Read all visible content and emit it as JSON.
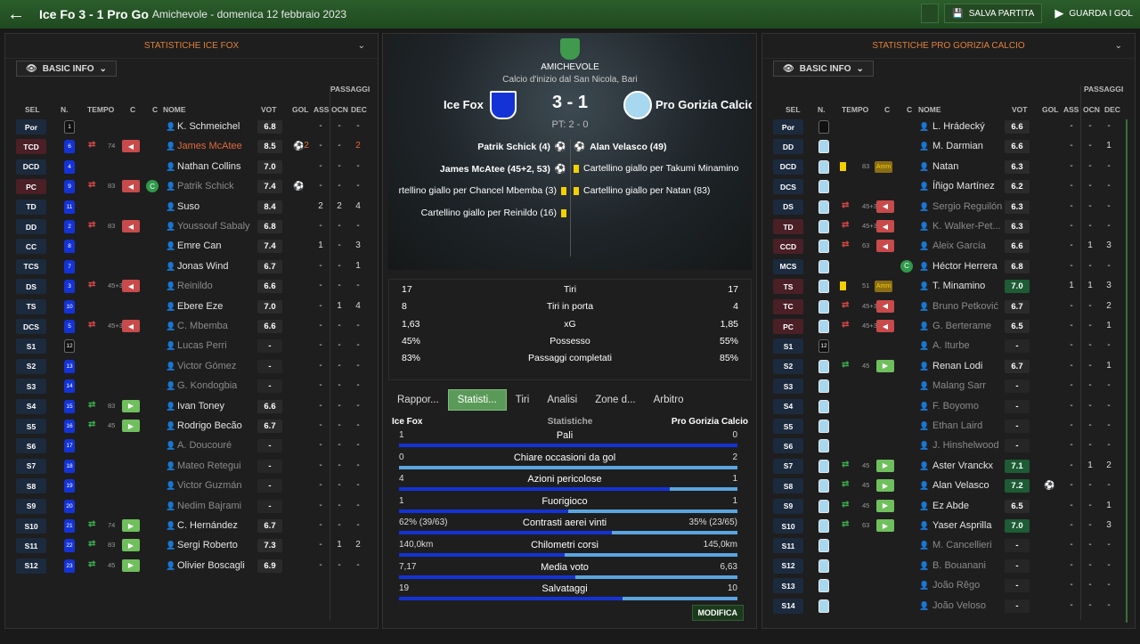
{
  "topbar": {
    "title": "Ice Fo 3 - 1 Pro Go",
    "subtitle": "Amichevole - domenica 12 febbraio 2023",
    "save_label": "SALVA PARTITA",
    "goals_label": "GUARDA I GOL"
  },
  "left": {
    "header": "STATISTICHE ICE FOX",
    "basic_info": "BASIC INFO",
    "passaggi": "PASSAGGI",
    "columns": {
      "sel": "SEL",
      "n": "N.",
      "tempo": "TEMPO",
      "c1": "C",
      "c2": "C",
      "nome": "NOME",
      "vot": "VOT",
      "gol": "GOL",
      "ass": "ASS",
      "ocn": "OCN",
      "dec": "DEC"
    },
    "players": [
      {
        "pos": "Por",
        "num": "1",
        "name": "K. Schmeichel",
        "rating": "6.8",
        "ass": "-",
        "ocn": "-",
        "dec": "-",
        "gk": true,
        "posred": false,
        "dim": false
      },
      {
        "pos": "TCD",
        "num": "6",
        "name": "James McAtee",
        "rating": "8.5",
        "gol": "2",
        "ass": "-",
        "ocn": "-",
        "dec": "2",
        "posred": true,
        "hl": true,
        "sub": "out",
        "mins": "74",
        "arrow": "out"
      },
      {
        "pos": "DCD",
        "num": "4",
        "name": "Nathan Collins",
        "rating": "7.0",
        "ass": "-",
        "ocn": "-",
        "dec": "-"
      },
      {
        "pos": "PC",
        "num": "9",
        "name": "Patrik Schick",
        "rating": "7.4",
        "gol": "1",
        "ass": "-",
        "ocn": "-",
        "dec": "-",
        "posred": true,
        "dim": true,
        "sub": "out",
        "mins": "83",
        "arrow": "out",
        "circ": "C"
      },
      {
        "pos": "TD",
        "num": "11",
        "name": "Suso",
        "rating": "8.4",
        "ass": "2",
        "ocn": "2",
        "dec": "4"
      },
      {
        "pos": "DD",
        "num": "2",
        "name": "Youssouf Sabaly",
        "rating": "6.8",
        "ass": "-",
        "ocn": "-",
        "dec": "-",
        "dim": true,
        "sub": "out",
        "mins": "83",
        "arrow": "out"
      },
      {
        "pos": "CC",
        "num": "8",
        "name": "Emre Can",
        "rating": "7.4",
        "ass": "1",
        "ocn": "-",
        "dec": "3"
      },
      {
        "pos": "TCS",
        "num": "7",
        "name": "Jonas Wind",
        "rating": "6.7",
        "ass": "-",
        "ocn": "-",
        "dec": "1"
      },
      {
        "pos": "DS",
        "num": "3",
        "name": "Reinildo",
        "rating": "6.6",
        "ass": "-",
        "ocn": "-",
        "dec": "-",
        "dim": true,
        "sub": "out",
        "mins": "45+3",
        "arrow": "out"
      },
      {
        "pos": "TS",
        "num": "10",
        "name": "Ebere Eze",
        "rating": "7.0",
        "ass": "-",
        "ocn": "1",
        "dec": "4"
      },
      {
        "pos": "DCS",
        "num": "5",
        "name": "C. Mbemba",
        "rating": "6.6",
        "ass": "-",
        "ocn": "-",
        "dec": "-",
        "dim": true,
        "sub": "out",
        "mins": "45+3",
        "arrow": "out"
      },
      {
        "pos": "S1",
        "num": "12",
        "name": "Lucas Perri",
        "rating": "-",
        "ass": "-",
        "ocn": "-",
        "dec": "-",
        "gk": true,
        "dim": true
      },
      {
        "pos": "S2",
        "num": "13",
        "name": "Victor Gómez",
        "rating": "-",
        "ass": "-",
        "ocn": "-",
        "dec": "-",
        "dim": true
      },
      {
        "pos": "S3",
        "num": "14",
        "name": "G. Kondogbia",
        "rating": "-",
        "ass": "-",
        "ocn": "-",
        "dec": "-",
        "dim": true
      },
      {
        "pos": "S4",
        "num": "15",
        "name": "Ivan Toney",
        "rating": "6.6",
        "ass": "-",
        "ocn": "-",
        "dec": "-",
        "sub": "in",
        "mins": "83",
        "arrow": "in"
      },
      {
        "pos": "S5",
        "num": "16",
        "name": "Rodrigo Becão",
        "rating": "6.7",
        "ass": "-",
        "ocn": "-",
        "dec": "-",
        "sub": "in",
        "mins": "45",
        "arrow": "in"
      },
      {
        "pos": "S6",
        "num": "17",
        "name": "A. Doucouré",
        "rating": "-",
        "ass": "-",
        "ocn": "-",
        "dec": "-",
        "dim": true
      },
      {
        "pos": "S7",
        "num": "18",
        "name": "Mateo Retegui",
        "rating": "-",
        "ass": "-",
        "ocn": "-",
        "dec": "-",
        "dim": true
      },
      {
        "pos": "S8",
        "num": "19",
        "name": "Victor Guzmán",
        "rating": "-",
        "ass": "-",
        "ocn": "-",
        "dec": "-",
        "dim": true
      },
      {
        "pos": "S9",
        "num": "20",
        "name": "Nedim Bajrami",
        "rating": "-",
        "ass": "-",
        "ocn": "-",
        "dec": "-",
        "dim": true
      },
      {
        "pos": "S10",
        "num": "21",
        "name": "C. Hernández",
        "rating": "6.7",
        "ass": "-",
        "ocn": "-",
        "dec": "-",
        "sub": "in",
        "mins": "74",
        "arrow": "in"
      },
      {
        "pos": "S11",
        "num": "22",
        "name": "Sergi Roberto",
        "rating": "7.3",
        "ass": "-",
        "ocn": "1",
        "dec": "2",
        "sub": "in",
        "mins": "83",
        "arrow": "in"
      },
      {
        "pos": "S12",
        "num": "23",
        "name": "Olivier Boscagli",
        "rating": "6.9",
        "ass": "-",
        "ocn": "-",
        "dec": "-",
        "sub": "in",
        "mins": "45",
        "arrow": "in"
      }
    ]
  },
  "center": {
    "competition": "AMICHEVOLE",
    "venue": "Calcio d'inizio dal San Nicola, Bari",
    "home_team": "Ice Fox",
    "away_team": "Pro Gorizia Calcio",
    "score": "3 - 1",
    "halftime": "PT: 2 - 0",
    "home_events": [
      {
        "text": "Patrik Schick (4)",
        "type": "goal"
      },
      {
        "text": "James McAtee (45+2, 53)",
        "type": "goal"
      },
      {
        "text": "rtellino giallo per Chancel Mbemba (3)",
        "type": "yellow"
      },
      {
        "text": "Cartellino giallo per Reinildo (16)",
        "type": "yellow"
      }
    ],
    "away_events": [
      {
        "text": "Alan Velasco (49)",
        "type": "goal"
      },
      {
        "text": "Cartellino giallo per Takumi Minamino",
        "type": "yellow"
      },
      {
        "text": "Cartellino giallo per Natan (83)",
        "type": "yellow"
      }
    ],
    "summary": [
      {
        "l": "17",
        "m": "Tiri",
        "r": "17"
      },
      {
        "l": "8",
        "m": "Tiri in porta",
        "r": "4"
      },
      {
        "l": "1,63",
        "m": "xG",
        "r": "1,85"
      },
      {
        "l": "45%",
        "m": "Possesso",
        "r": "55%"
      },
      {
        "l": "83%",
        "m": "Passaggi completati",
        "r": "85%"
      }
    ],
    "tabs": [
      "Rappor...",
      "Statisti...",
      "Tiri",
      "Analisi",
      "Zone d...",
      "Arbitro"
    ],
    "compare_head": {
      "home": "Ice Fox",
      "mid": "Statistiche",
      "away": "Pro Gorizia Calcio"
    },
    "compare": [
      {
        "l": "1",
        "m": "Pali",
        "r": "0",
        "frac": 1.0
      },
      {
        "l": "0",
        "m": "Chiare occasioni da gol",
        "r": "2",
        "frac": 0.0
      },
      {
        "l": "4",
        "m": "Azioni pericolose",
        "r": "1",
        "frac": 0.8
      },
      {
        "l": "1",
        "m": "Fuorigioco",
        "r": "1",
        "frac": 0.5
      },
      {
        "l": "62% (39/63)",
        "m": "Contrasti aerei vinti",
        "r": "35% (23/65)",
        "frac": 0.63
      },
      {
        "l": "140,0km",
        "m": "Chilometri corsi",
        "r": "145,0km",
        "frac": 0.49
      },
      {
        "l": "7,17",
        "m": "Media voto",
        "r": "6,63",
        "frac": 0.52
      },
      {
        "l": "19",
        "m": "Salvataggi",
        "r": "10",
        "frac": 0.66
      }
    ],
    "modifica": "MODIFICA"
  },
  "right": {
    "header": "STATISTICHE PRO GORIZIA CALCIO",
    "basic_info": "BASIC INFO",
    "passaggi": "PASSAGGI",
    "columns": {
      "sel": "SEL",
      "n": "N.",
      "tempo": "TEMPO",
      "c1": "C",
      "c2": "C",
      "nome": "NOME",
      "vot": "VOT",
      "gol": "GOL",
      "ass": "ASS",
      "ocn": "OCN",
      "dec": "DEC"
    },
    "players": [
      {
        "pos": "Por",
        "name": "L. Hrádecký",
        "rating": "6.6",
        "ass": "-",
        "ocn": "-",
        "dec": "-",
        "gk": true
      },
      {
        "pos": "DD",
        "name": "M. Darmian",
        "rating": "6.6",
        "ass": "-",
        "ocn": "-",
        "dec": "1"
      },
      {
        "pos": "DCD",
        "name": "Natan",
        "rating": "6.3",
        "ass": "-",
        "ocn": "-",
        "dec": "-",
        "card": true,
        "mins": "83",
        "amm": "Amm"
      },
      {
        "pos": "DCS",
        "name": "Íñigo Martínez",
        "rating": "6.2",
        "ass": "-",
        "ocn": "-",
        "dec": "-"
      },
      {
        "pos": "DS",
        "name": "Sergio Reguilón",
        "rating": "6.3",
        "ass": "-",
        "ocn": "-",
        "dec": "-",
        "dim": true,
        "sub": "out",
        "mins": "45+3",
        "arrow": "out"
      },
      {
        "pos": "TD",
        "name": "K. Walker-Pet...",
        "rating": "6.3",
        "ass": "-",
        "ocn": "-",
        "dec": "-",
        "dim": true,
        "sub": "out",
        "mins": "45+3",
        "arrow": "out",
        "posred": true
      },
      {
        "pos": "CCD",
        "name": "Aleix García",
        "rating": "6.6",
        "ass": "-",
        "ocn": "1",
        "dec": "3",
        "dim": true,
        "sub": "out",
        "mins": "63",
        "arrow": "out",
        "posred": true
      },
      {
        "pos": "MCS",
        "name": "Héctor Herrera",
        "rating": "6.8",
        "ass": "-",
        "ocn": "-",
        "dec": "-",
        "circ": "C"
      },
      {
        "pos": "TS",
        "name": "T. Minamino",
        "rating": "7.0",
        "ass": "1",
        "ocn": "1",
        "dec": "3",
        "card": true,
        "mins": "51",
        "amm": "Amm",
        "posred": true,
        "green": true
      },
      {
        "pos": "TC",
        "name": "Bruno Petković",
        "rating": "6.7",
        "ass": "-",
        "ocn": "-",
        "dec": "2",
        "dim": true,
        "sub": "out",
        "mins": "45+3",
        "arrow": "out",
        "posred": true
      },
      {
        "pos": "PC",
        "name": "G. Berterame",
        "rating": "6.5",
        "ass": "-",
        "ocn": "-",
        "dec": "1",
        "dim": true,
        "sub": "out",
        "mins": "45+3",
        "arrow": "out",
        "posred": true
      },
      {
        "pos": "S1",
        "name": "A. Iturbe",
        "rating": "-",
        "ass": "-",
        "ocn": "-",
        "dec": "-",
        "dim": true,
        "gk": true,
        "num": "12"
      },
      {
        "pos": "S2",
        "name": "Renan Lodi",
        "rating": "6.7",
        "ass": "-",
        "ocn": "-",
        "dec": "1",
        "sub": "in",
        "mins": "45",
        "arrow": "in"
      },
      {
        "pos": "S3",
        "name": "Malang Sarr",
        "rating": "-",
        "ass": "-",
        "ocn": "-",
        "dec": "-",
        "dim": true
      },
      {
        "pos": "S4",
        "name": "F. Boyomo",
        "rating": "-",
        "ass": "-",
        "ocn": "-",
        "dec": "-",
        "dim": true
      },
      {
        "pos": "S5",
        "name": "Ethan Laird",
        "rating": "-",
        "ass": "-",
        "ocn": "-",
        "dec": "-",
        "dim": true
      },
      {
        "pos": "S6",
        "name": "J. Hinshelwood",
        "rating": "-",
        "ass": "-",
        "ocn": "-",
        "dec": "-",
        "dim": true
      },
      {
        "pos": "S7",
        "name": "Aster Vranckx",
        "rating": "7.1",
        "ass": "-",
        "ocn": "1",
        "dec": "2",
        "sub": "in",
        "mins": "45",
        "arrow": "in",
        "green": true
      },
      {
        "pos": "S8",
        "name": "Alan Velasco",
        "rating": "7.2",
        "gol": "1",
        "ass": "-",
        "ocn": "-",
        "dec": "-",
        "sub": "in",
        "mins": "45",
        "arrow": "in",
        "green": true
      },
      {
        "pos": "S9",
        "name": "Ez Abde",
        "rating": "6.5",
        "ass": "-",
        "ocn": "-",
        "dec": "1",
        "sub": "in",
        "mins": "45",
        "arrow": "in"
      },
      {
        "pos": "S10",
        "name": "Yaser Asprilla",
        "rating": "7.0",
        "ass": "-",
        "ocn": "-",
        "dec": "3",
        "sub": "in",
        "mins": "63",
        "arrow": "in",
        "green": true
      },
      {
        "pos": "S11",
        "name": "M. Cancellieri",
        "rating": "-",
        "ass": "-",
        "ocn": "-",
        "dec": "-",
        "dim": true
      },
      {
        "pos": "S12",
        "name": "B. Bouanani",
        "rating": "-",
        "ass": "-",
        "ocn": "-",
        "dec": "-",
        "dim": true
      },
      {
        "pos": "S13",
        "name": "João Rêgo",
        "rating": "-",
        "ass": "-",
        "ocn": "-",
        "dec": "-",
        "dim": true
      },
      {
        "pos": "S14",
        "name": "João Veloso",
        "rating": "-",
        "ass": "-",
        "ocn": "-",
        "dec": "-",
        "dim": true
      }
    ]
  },
  "colors": {
    "accent": "#2b5d2b",
    "home": "#1433d6",
    "away": "#a8d7f0",
    "header_orange": "#e0803a"
  }
}
